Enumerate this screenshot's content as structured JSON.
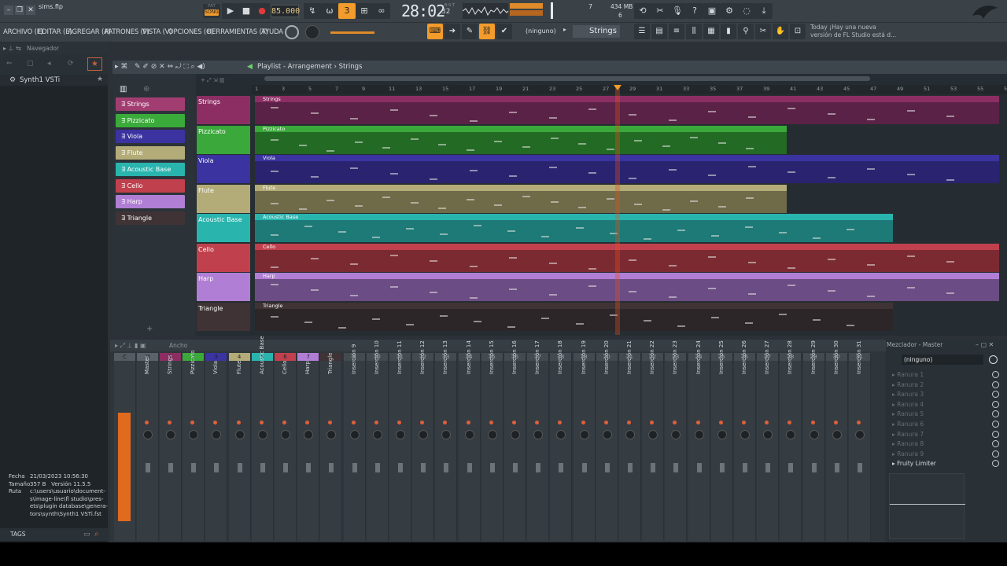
{
  "window": {
    "filename": "sims.flp"
  },
  "transport": {
    "tempo": "85.000",
    "song_label": "SONG",
    "pattern_label": "PAT",
    "clock": "28:02",
    "clock_small": "32",
    "clock_small_label": "B:S:T",
    "memory": "434 MB",
    "cpu_top": "7",
    "cpu_bottom": "6"
  },
  "menu": {
    "items": [
      "ARCHIVO (F)",
      "EDITAR (E)",
      "AGREGAR (A)",
      "PATRONES (P)",
      "VISTA (V)",
      "OPCIONES (O)",
      "HERRAMIENTAS (T)",
      "AYUDA"
    ]
  },
  "toolbar": {
    "ninguno": "(ninguno)",
    "channel": "Strings"
  },
  "hint": {
    "line1": "Today  ¡Hay una nueva",
    "line2": "versión de FL Studio está d..."
  },
  "browser": {
    "header": "Navegador",
    "item": "Synth1 VSTi",
    "info_labels": [
      "Fecha",
      "Tamaño",
      "Ruta"
    ],
    "date": "21/03/2023 10:56:30",
    "size": "357 B",
    "version_label": "Versión",
    "version": "11.5.5",
    "path": [
      "c:\\users\\usuario\\document-",
      "s\\image-line\\fl studio\\pres-",
      "ets\\plugin database\\genera-",
      "tors\\synth\\Synth1 VSTi.fst"
    ],
    "tags": "TAGS"
  },
  "playlist": {
    "title": "Playlist - Arrangement",
    "title_sub": "Strings"
  },
  "patterns": [
    {
      "name": "Strings",
      "color": "#a23d72"
    },
    {
      "name": "Pizzicato",
      "color": "#3aaa3a"
    },
    {
      "name": "Viola",
      "color": "#3a33a0"
    },
    {
      "name": "Flute",
      "color": "#b3ab78"
    },
    {
      "name": "Acoustic Base",
      "color": "#2ab4ae"
    },
    {
      "name": "Cello",
      "color": "#c0414d"
    },
    {
      "name": "Harp",
      "color": "#b07ed4"
    },
    {
      "name": "Triangle",
      "color": "#3f3335"
    }
  ],
  "tracks": [
    {
      "name": "Strings",
      "color": "#8c2e63",
      "body": "#5a2246",
      "end": 1270
    },
    {
      "name": "Pizzicato",
      "color": "#3aa83a",
      "body": "#236b24",
      "end": 1000
    },
    {
      "name": "Viola",
      "color": "#3a33a0",
      "body": "#2a2470",
      "end": 1270
    },
    {
      "name": "Flute",
      "color": "#b3ab78",
      "body": "#6f6a48",
      "end": 1000
    },
    {
      "name": "Acoustic Base",
      "color": "#2ab4ae",
      "body": "#1d7a76",
      "end": 1135
    },
    {
      "name": "Cello",
      "color": "#c0414d",
      "body": "#7c2a32",
      "end": 1270
    },
    {
      "name": "Harp",
      "color": "#b07ed4",
      "body": "#6c4c84",
      "end": 1270
    },
    {
      "name": "Triangle",
      "color": "#3f3335",
      "body": "#2c2628",
      "end": 1135
    }
  ],
  "ruler": [
    "1",
    "3",
    "5",
    "7",
    "9",
    "11",
    "13",
    "15",
    "17",
    "19",
    "21",
    "23",
    "25",
    "27",
    "29",
    "31",
    "33",
    "35",
    "37",
    "39",
    "41",
    "43",
    "45",
    "47",
    "49",
    "51",
    "53",
    "55",
    "57"
  ],
  "mixer": {
    "header": "Ancho",
    "title": "Mezclador - Master",
    "selector": "(ninguno)",
    "slots": [
      "Ranura 1",
      "Ranura 2",
      "Ranura 3",
      "Ranura 4",
      "Ranura 5",
      "Ranura 6",
      "Ranura 7",
      "Ranura 8",
      "Ranura 9"
    ],
    "limiter": "Fruity Limiter",
    "strips": [
      {
        "num": "C",
        "name": "",
        "color": "#555c61"
      },
      {
        "num": "M",
        "name": "Master",
        "color": "#5a636a"
      },
      {
        "num": "1",
        "name": "Strings",
        "color": "#8c2e63"
      },
      {
        "num": "2",
        "name": "Pizzicato",
        "color": "#3aa83a"
      },
      {
        "num": "3",
        "name": "Viola",
        "color": "#3a33a0"
      },
      {
        "num": "4",
        "name": "Flute",
        "color": "#b3ab78"
      },
      {
        "num": "5",
        "name": "Acoustic Base",
        "color": "#2ab4ae"
      },
      {
        "num": "6",
        "name": "Cello",
        "color": "#c0414d"
      },
      {
        "num": "7",
        "name": "Harp",
        "color": "#b07ed4"
      },
      {
        "num": "8",
        "name": "Triangle",
        "color": "#3f3335"
      },
      {
        "num": "9",
        "name": "Inserción 9",
        "color": "#434b51"
      },
      {
        "num": "10",
        "name": "Inserción 10",
        "color": "#434b51"
      },
      {
        "num": "11",
        "name": "Inserción 11",
        "color": "#434b51"
      },
      {
        "num": "12",
        "name": "Inserción 12",
        "color": "#434b51"
      },
      {
        "num": "13",
        "name": "Inserción 13",
        "color": "#434b51"
      },
      {
        "num": "14",
        "name": "Inserción 14",
        "color": "#434b51"
      },
      {
        "num": "15",
        "name": "Inserción 15",
        "color": "#434b51"
      },
      {
        "num": "16",
        "name": "Inserción 16",
        "color": "#434b51"
      },
      {
        "num": "17",
        "name": "Inserción 17",
        "color": "#434b51"
      },
      {
        "num": "18",
        "name": "Inserción 18",
        "color": "#434b51"
      },
      {
        "num": "19",
        "name": "Inserción 19",
        "color": "#434b51"
      },
      {
        "num": "20",
        "name": "Inserción 20",
        "color": "#434b51"
      },
      {
        "num": "21",
        "name": "Inserción 21",
        "color": "#434b51"
      },
      {
        "num": "22",
        "name": "Inserción 22",
        "color": "#434b51"
      },
      {
        "num": "23",
        "name": "Inserción 23",
        "color": "#434b51"
      },
      {
        "num": "24",
        "name": "Inserción 24",
        "color": "#434b51"
      },
      {
        "num": "25",
        "name": "Inserción 25",
        "color": "#434b51"
      },
      {
        "num": "26",
        "name": "Inserción 26",
        "color": "#434b51"
      },
      {
        "num": "27",
        "name": "Inserción 27",
        "color": "#434b51"
      },
      {
        "num": "28",
        "name": "Inserción 28",
        "color": "#434b51"
      },
      {
        "num": "29",
        "name": "Inserción 29",
        "color": "#434b51"
      },
      {
        "num": "30",
        "name": "Inserción 30",
        "color": "#434b51"
      },
      {
        "num": "31",
        "name": "Inserción 31",
        "color": "#434b51"
      }
    ]
  }
}
